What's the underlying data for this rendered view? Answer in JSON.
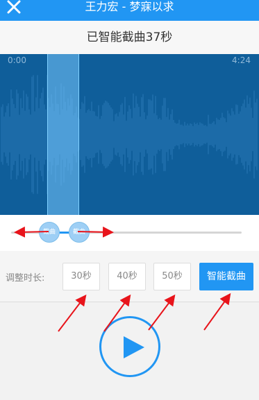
{
  "header": {
    "title": "王力宏 - 梦寐以求",
    "close_icon": "close-icon"
  },
  "subheader": {
    "text": "已智能截曲37秒"
  },
  "waveform": {
    "time_start": "0:00",
    "time_end": "4:24"
  },
  "slider": {
    "handle_left_label": "截曲",
    "handle_right_label": "截曲"
  },
  "adjust": {
    "label": "调整时长:",
    "options": [
      "30秒",
      "40秒",
      "50秒",
      "智能截曲"
    ]
  },
  "player": {
    "play_icon": "play-icon"
  },
  "colors": {
    "accent": "#2196f3",
    "waveform_bg": "#0f5e9a",
    "annotation": "#e8141b"
  }
}
